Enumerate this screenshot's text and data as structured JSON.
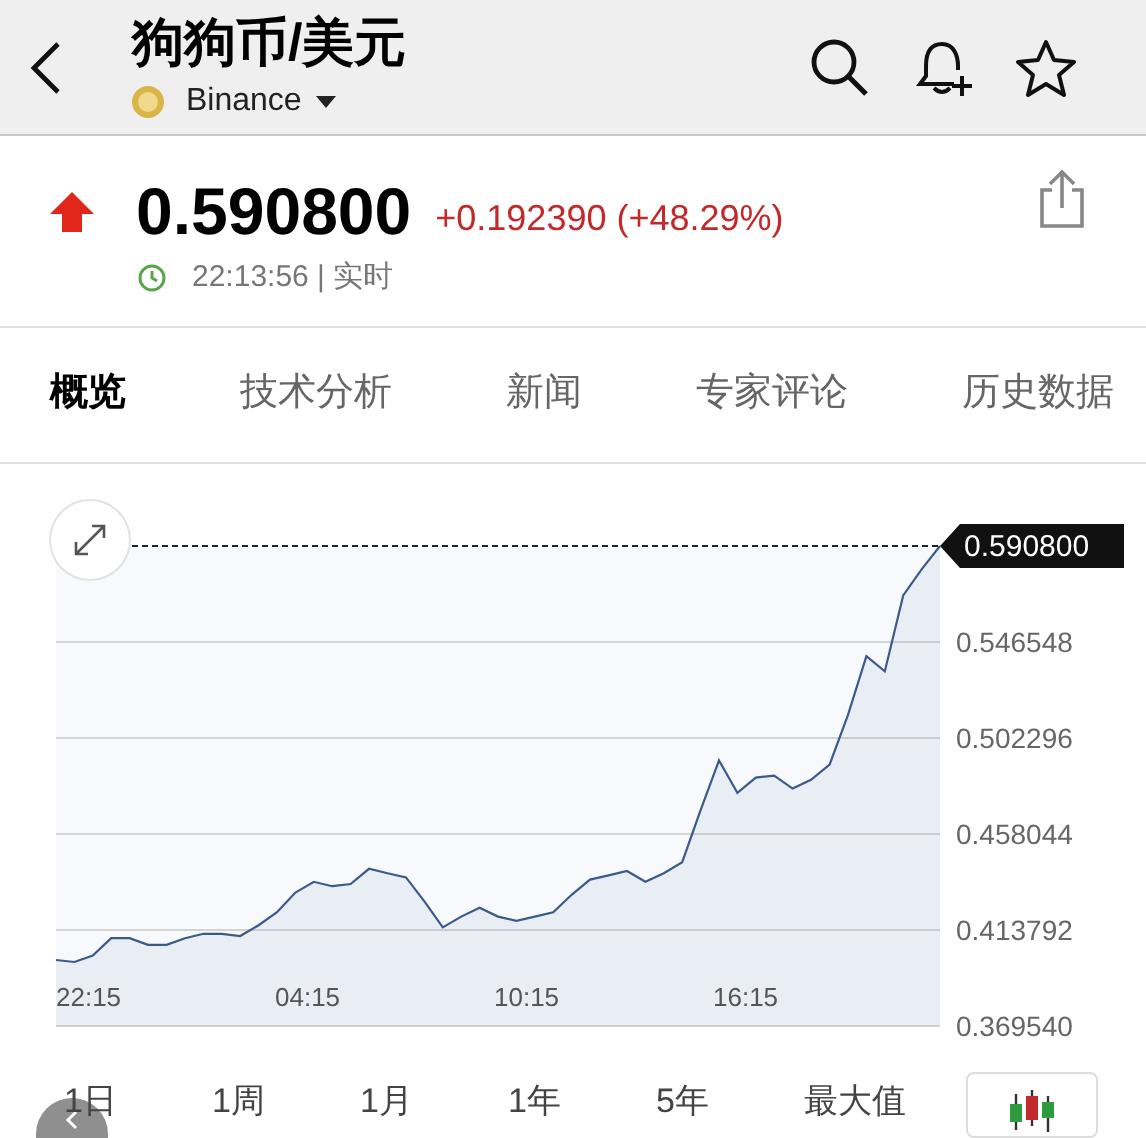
{
  "header": {
    "title": "狗狗币/美元",
    "exchange": "Binance"
  },
  "quote": {
    "price": "0.590800",
    "change": "+0.192390 (+48.29%)",
    "time": "22:13:56 | 实时"
  },
  "tabs": [
    {
      "label": "概览",
      "selected": true
    },
    {
      "label": "技术分析",
      "selected": false
    },
    {
      "label": "新闻",
      "selected": false
    },
    {
      "label": "专家评论",
      "selected": false
    },
    {
      "label": "历史数据",
      "selected": false
    }
  ],
  "chart": {
    "chart_data": {
      "type": "area",
      "series": [
        {
          "color": "#3b5a8c",
          "values": [
            0.4,
            0.399,
            0.402,
            0.41,
            0.41,
            0.407,
            0.407,
            0.41,
            0.412,
            0.412,
            0.411,
            0.416,
            0.422,
            0.431,
            0.436,
            0.434,
            0.435,
            0.442,
            0.44,
            0.438,
            0.427,
            0.415,
            0.42,
            0.424,
            0.42,
            0.418,
            0.42,
            0.422,
            0.43,
            0.437,
            0.439,
            0.441,
            0.436,
            0.44,
            0.445,
            0.469,
            0.492,
            0.477,
            0.484,
            0.485,
            0.479,
            0.483,
            0.49,
            0.513,
            0.54,
            0.533,
            0.568,
            0.58,
            0.5908
          ]
        }
      ],
      "ylim": [
        0.36954,
        0.5908
      ],
      "grid": true,
      "yticks": [
        {
          "value": 0.546548,
          "label": "0.546548"
        },
        {
          "value": 0.502296,
          "label": "0.502296"
        },
        {
          "value": 0.458044,
          "label": "0.458044"
        },
        {
          "value": 0.413792,
          "label": "0.413792"
        },
        {
          "value": 0.36954,
          "label": "0.369540"
        }
      ],
      "annotations": [
        "0.590800"
      ]
    },
    "time_labels": [
      "22:15",
      "04:15",
      "10:15",
      "16:15"
    ]
  },
  "ranges": [
    "1日",
    "1周",
    "1月",
    "1年",
    "5年",
    "最大值"
  ]
}
